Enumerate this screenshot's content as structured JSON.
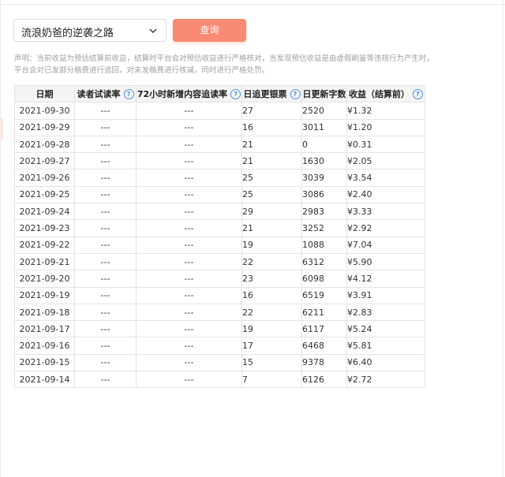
{
  "book_select": {
    "value": "流浪奶爸的逆袭之路",
    "icon": "chevron-down-icon"
  },
  "query_button": {
    "label": "查询",
    "color": "#f98a73"
  },
  "notice": {
    "line1": "声明：当前收益为预估结算前收益，结算时平台会对预估收益进行严格核对，当发现预估收益是由虚假刷量等违规行为产生时，",
    "line2": "平台会对已发部分稿费进行追回，对未发稿费进行核减，同时进行严格处罚。"
  },
  "table": {
    "columns": {
      "date": "日期",
      "read_rate": "读者试读率",
      "follow_rate": "72小时新增内容追读率",
      "tickets": "日追更银票",
      "words": "日更新字数",
      "income": "收益（结算前）"
    },
    "help_icon": "question-circle-icon",
    "rows": [
      {
        "date": "2021-09-30",
        "read_rate": "---",
        "follow_rate": "---",
        "tickets": "27",
        "words": "2520",
        "income": "¥1.32"
      },
      {
        "date": "2021-09-29",
        "read_rate": "---",
        "follow_rate": "---",
        "tickets": "16",
        "words": "3011",
        "income": "¥1.20"
      },
      {
        "date": "2021-09-28",
        "read_rate": "---",
        "follow_rate": "---",
        "tickets": "21",
        "words": "0",
        "income": "¥0.31"
      },
      {
        "date": "2021-09-27",
        "read_rate": "---",
        "follow_rate": "---",
        "tickets": "21",
        "words": "1630",
        "income": "¥2.05"
      },
      {
        "date": "2021-09-26",
        "read_rate": "---",
        "follow_rate": "---",
        "tickets": "25",
        "words": "3039",
        "income": "¥3.54"
      },
      {
        "date": "2021-09-25",
        "read_rate": "---",
        "follow_rate": "---",
        "tickets": "25",
        "words": "3086",
        "income": "¥2.40"
      },
      {
        "date": "2021-09-24",
        "read_rate": "---",
        "follow_rate": "---",
        "tickets": "29",
        "words": "2983",
        "income": "¥3.33"
      },
      {
        "date": "2021-09-23",
        "read_rate": "---",
        "follow_rate": "---",
        "tickets": "21",
        "words": "3252",
        "income": "¥2.92"
      },
      {
        "date": "2021-09-22",
        "read_rate": "---",
        "follow_rate": "---",
        "tickets": "19",
        "words": "1088",
        "income": "¥7.04"
      },
      {
        "date": "2021-09-21",
        "read_rate": "---",
        "follow_rate": "---",
        "tickets": "22",
        "words": "6312",
        "income": "¥5.90"
      },
      {
        "date": "2021-09-20",
        "read_rate": "---",
        "follow_rate": "---",
        "tickets": "23",
        "words": "6098",
        "income": "¥4.12"
      },
      {
        "date": "2021-09-19",
        "read_rate": "---",
        "follow_rate": "---",
        "tickets": "16",
        "words": "6519",
        "income": "¥3.91"
      },
      {
        "date": "2021-09-18",
        "read_rate": "---",
        "follow_rate": "---",
        "tickets": "22",
        "words": "6211",
        "income": "¥2.83"
      },
      {
        "date": "2021-09-17",
        "read_rate": "---",
        "follow_rate": "---",
        "tickets": "19",
        "words": "6117",
        "income": "¥5.24"
      },
      {
        "date": "2021-09-16",
        "read_rate": "---",
        "follow_rate": "---",
        "tickets": "17",
        "words": "6468",
        "income": "¥5.81"
      },
      {
        "date": "2021-09-15",
        "read_rate": "---",
        "follow_rate": "---",
        "tickets": "15",
        "words": "9378",
        "income": "¥6.40"
      },
      {
        "date": "2021-09-14",
        "read_rate": "---",
        "follow_rate": "---",
        "tickets": "7",
        "words": "6126",
        "income": "¥2.72"
      }
    ]
  }
}
